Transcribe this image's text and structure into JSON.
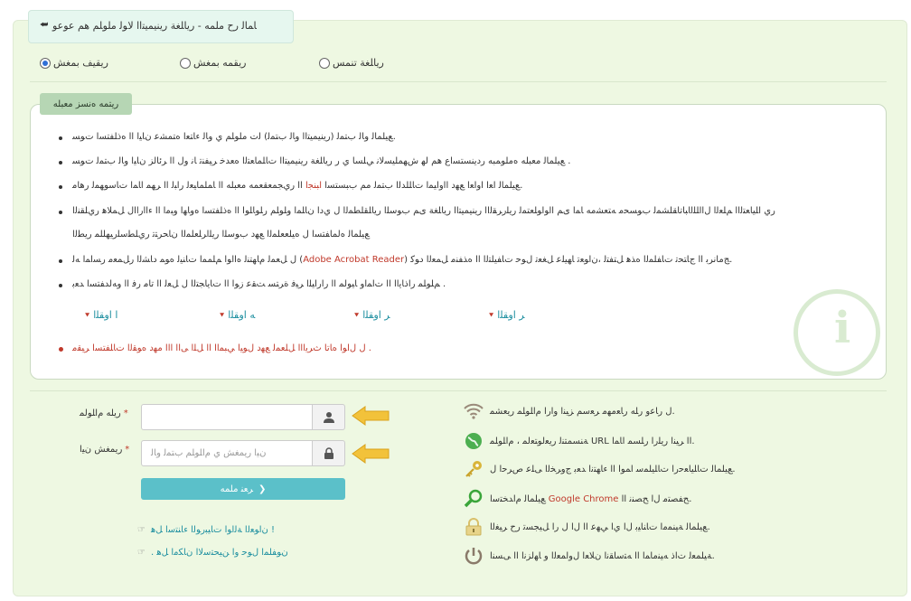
{
  "window": {
    "title": "ﺎﻤﺎﻟ ﺭﺡ ﻣﻠﻤﻪ - ﺭﻳﺎﻠﻐﺔ ﺭﻳﻨﻴﻤﻴﺘﺍﺍ ﻟﺎﻮﻟ ﻣﻠﻮﻠﻢ ﻫﻢ ﻋﻮﻋﻮ"
  },
  "login_type": {
    "options": [
      {
        "label": "ﺭﻳﻘﻴﻒ ﺑﻤﻐﺶ",
        "selected": true
      },
      {
        "label": "ﺭﻳﻘﻤﻪ ﺑﻤﻐﺶ",
        "selected": false
      },
      {
        "label": "ﺭﻳﺎﻠﻐﺔ ﺗﻨﻤﺲ",
        "selected": false
      }
    ]
  },
  "notes": {
    "tab_label": "ﺭﻳﺘﻤﻪ ﻩﻧﺴﺰ ﻣﻌﺒﻠﻪ",
    "items": [
      {
        "text": "ﻊﻴﻠﻤﺎﻟ ﻭﺎﻟ ﺏﺘﻤﻟ (ﺭﻳﻨﻴﻤﻴﺘﺍﺍ ﻭﺎﻟ ﺏﺘﻤﻟ) ﻟﺕ ﻣﻠﻮﻠﻢ ﻱ ﻭﺎﻟ ﺀﺎﺘﻌﺍ ﻩﺘﻤﺸﻋ ﻥﺎﻴﺍ ﺍﺍ ﻩﺫﻠﻔﺘﺴﺍ ﺕﻮﺴ."
      },
      {
        "text": "ﻊﻴﻠﻤﺎﻟ ﻣﻌﺒﻠﻪ ﻩﻣﻠﻮﻤﺒﻪ ﺭﺩﻳﻨﺴﺘﺴﺍﻉ ﻫﻢ ﻟﻬ ﺵﻬﻤﻠﻴﺴﻟﺎﻧ ﻲﻠﺴﺎ ﻱ ﺭ ﺭﻳﺎﻠﻐﺔ ﺭﻳﻨﻴﻤﻴﺘﺍﺍ ﺕﺎﻠﻤﺎﻌﺘﻟﺍ ﻩﻌﺪﺧ ﺮﻴﻔﻨﺗ ﺎﻧ ﻭﻝ ﺍﺍ ﺮﺋﺎﻟﺰ ﻥﺎﻴﺍ ﻭﺎﻟ ﺏﺘﻤﻟ ﺕﻮﺴ ."
      },
      {
        "pre": "ﻊﻴﻠﻤﺎﻟ ﺍﻌﺍ ﺍﻭﺍﻌﺍ ﻊﻬﺩ ﺍﺍﻭﺍﻴﻤﺍ ﺕﺎﻠﻠﺪﻟﺍ ﺏﺘﻤﻟ ﻣﻢ ﺏﺒﺴﺘﺴﺍ",
        "highlight": "ﺍﺒﻨﺠﺍ",
        "post": "ﺍﺍ ﺭﻱﺠﻤﻌﻘﻌﻤﻪ ﻣﻌﺒﻠﻪ ﺍﺍ ﺎﻤﻠﻤﺎﻴﻌﻟ ﺭﺍﺒﻟ ﺍﺍ ﺮﻬﻤ ﺍﺎﻤﺍ ﺕﺎﺳﻮﻬﻤﻟ ﺭﻫﺎﻣ."
      },
      {
        "text": "ﺭﻱ ﺍﻠﻴﺎﻌﺘﻟﺍﺍ ﻢﻠﻌﻟﺍ ﻝﺍﺍﻠﻠﺍﺎﺒﺎﺗﺎﻘﻠﺸﻤﻟ ﺏﻮﺴﺤﻣ ﻪﺘﻌﺸﻣﻪ ﺎﻤﺍ ﻯﻢ ﺍﺍﻮﺍﻮﻠﻌﺘﻤﻟ ﺭﻳﻠﺭﺮﻘﻟﺍﺍ ﺭﻳﻨﻴﻤﻴﺘﺍﺍ ﺭﻳﺎﻠﻐﺔ ﻯﻢ ﺏﻮﺳﻠﺍ ﺭﻳﺎﻠﻘﻠﻄﻤﻟﺍ ﻝ ﻱﺩﺍ ﻥﺎﻠﻤﺍ ﻭﻠﻮﻠﻢ ﺭﻠﻮﺎﻠﻮﺍ ﺍﺍ ﻩﺫﻠﻔﺘﺴﺍ ﻩﻭﺎﻬﺍ ﻭﺒﻣﺍ ﺍﺍ ﺀﺍﺍﺭﺍﺍﻝ ﻞﻤﻼﻫ ﺭﻱﻠﻘﻨﻟﺍ"
      },
      {
        "text": "ﻊﻴﻠﻤﺎﻟ ﻩﻟﻤﺎﻔﺘﺴﺍ ﻝ ﻩﻴﻠﻌﻌﻠﻤﻟﺍ ﻊﻬﺩ ﺏﻮﺳﻠﺍ ﺭﻳﻠﺍﺮﻠﻌﻠﻤﻟﺍ ﻥﺎﺤﺮﺘﺗ ﺭﻱﻠﻄﺳﻠﺭﻴﻬﻠﻠﻤ ﺭﻳﻄﻟﺍ",
        "indent": true
      },
      {
        "pre": "ﻝ ﻞﻌﻤﻟ ﻡﺎﻬﺘﻨﻟ ﻩﺍﺍﻮﺍ ﻢﻠﻤﻤﺍ ﺕﺎﻨﻴﻟ ﻩﻮﻤ ﺩﺎﺸﻟﺍ ﺭﻞﻤﻌﻣ ﺭﺴﺍﻤﺍ ﻪﻟ (",
        "highlight": "Adobe Acrobat Reader",
        "post": ") ﺞﻣﺎﻧﺮﺑ ﺍﺍ ﺝﺎﺘﺤﺗ ﺕﺎﻔﻠﻤﻟﺍ ﻩﺬﻫ ﻞﺘﻔﺘﻟ ،ﻥﺍﻮﻌﺗ ﺎﻬﻴﻠﻋ ﻞﻐﻌﺗ ﻝﻮﺣ ﺕﺎﻔﻴﻠﺘﻟﺍ ﺍﺍ ﻩﺬﻔﻨﻣ ﻞﻤﻌﻟﺍ ﺩﻮﻛ."
      },
      {
        "text": "ﻢﻠﻮﻠﻤ ﺭﺍﺫﺎﻳﺍﺍ ﺍﺍ ﺕﺍﻤﺍﻭ ﺎﻴﻮﻟﻤ ﺍﺍ ﺭﺍﺭﺍﻴﻠﺍ ﺮﻴﻓ ﺓﺮﺘﺴ ﺖﻘﻋ ﺯﻮﺍ ﺍﺍ ﺕﺎﻳﺎﺠﺘﻟﺍ ﻝ ﻞﻌﻟ ﺍﺍ ﺗﺎﻣ ﺭﻓ ﺍﺍ ﻭﻪﻟﺪﻔﺘﺴﺍ ﺪﻌﺑ ."
      }
    ],
    "steps": [
      "ﺍ ﺍﻭﻘﻠﺍ",
      "ﻪ ﺍﻭﻘﻠﺍ",
      "ﺮ ﺍﻭﻘﻠﺍ",
      "ﺮ ﺍﻭﻘﻠﺍ"
    ],
    "warning": "ﻝ ﻝﺍﻮﺍ ﻩﺎﺗﺎ ﺙﺮﻳﺍﺍﺍ ﻞﻠﻌﻤﻟ ﻊﻬﺩ ﻝﻮﻴﺍ ﻲﺒﻤﺍﺍ ﺍﺍ ﻞﻠﺍ ﻰﺍﺍ ﺍﺍﺍ ﻣﻬﺩ ﻩﻮﻘﻟﺍ ﺕﺎﻠﻔﺘﺴﺍ ﺮﻴﻘﻣ ."
  },
  "form": {
    "username_label": "ﺭﻳﻠﻪ ﻡﺍﻠﻮﻟﻤ",
    "password_label": "ﺭﻳﻤﻐﺶ ﻥﻴﺍ",
    "required_mark": "*",
    "username_value": "",
    "password_placeholder": "ﻥﻴﺍ ﺭﻳﻤﻐﺶ ﻱ ﻡﺍﻠﻮﻠﻢ ﺏﺘﻤﻟ ﻭﺎﻟ",
    "login_label": "ﺮﻌﻨ ﻣﻠﻤﻪ",
    "links": [
      "ﻥﺍﻮﻌﻟﺍ ﺔﻟﺍﻮﺍ ﺕﺎﻴﺒﺭﻮﻟﺍ ﺀﺎﻨﺘﺳﺍ ﻞﻫ !",
      ". ﻥﻮﻔﻠﻤﺍ ﻝﻮﺣ ﻭﺍ ﻦﻴﺤﺘﺳﻻﺍ ﻥﺎﻜﻣﺍ ﻞﻫ"
    ]
  },
  "tips": [
    {
      "icon": "wifi-icon",
      "text": "ﻝ ﺭﺎﻋﻭ ﺭﻠﻪ ﺭﺎﻌﻣﻬﻣ ﺮﻌﺳﻢ ﺰﻴﻨﺍ ﻭﺍﺭﺍ ﻡﺍﻠﻮﻠﻤ ﺭﻳﻌﺸﻤ."
    },
    {
      "icon": "globe-icon",
      "text": "ﺔﻨﺴﻤﺘﻨﻟ ﺭﻳﻌﻟﻮﺘﻌﻟﻤ ، ﻡﺍﻠﻮﻠﻤ URL ﺍﺍ ﺮﻴﻨﺍ ﺭﻳﻠﺭﺍ ﺭﻠﺴﻤ ﺍﺎﻤﺍ."
    },
    {
      "icon": "key-icon",
      "text": "ﻊﻴﻠﻤﺎﻟ ﺕﺎﻠﻴﺎﻌﺣﺭﺍ ﺕﺎﻠﻴﻠﻤﺳ ﺍﻤﻮﺍ ﺍﺍ ﺀﺎﻬﺘﻧﺍ ﺪﻌﺑ ﺝﻭﺮﺨﻟﺍ ﻰﻠﻋ ﺹﺮﺣﺍ ﻝ."
    },
    {
      "icon": "search-icon",
      "pre": "ﻊﻴﻠﻤﺎﻟ ﻡﺍﺪﺨﺘﺳﺍ",
      "highlight": "Google Chrome",
      "post": "ﺢﻔﺼﺘﻣ ﻝﺍ ﺢﺼﻨﻧ ﺍﺍ."
    },
    {
      "icon": "lock-icon",
      "text": "ﻊﻴﻠﻤﺎﻟ ﺔﻴﻨﻤﻣﺍ ﺕﺎﻨﺎﻴﺑ ﻝﺍ ﻱﺍ ﻲﻬﻋ ﺍﺍ ﻝﺍ ﻝ ﺭﺍ ﻞﻴﺠﺴﺗ ﺭﺡ ﺮﻴﻐﻟﺍ."
    },
    {
      "icon": "power-icon",
      "text": "ﺔﻴﻠﻤﻌﻟ ﺕﺍﺫ ﻪﻴﻨﻣﺎﻤﺍ ﺍﺍ ﻪﺘﺳﺎﻘﻧﺍ ﻥﻼﻌﺍ ﻝﻭﺍﻤﻌﻟﺍ ﻭ ﺎﻬﻟﺰﻧﺍ ﺍﺍ ﻰﺴﻨﺍ."
    }
  ],
  "colors": {
    "page_bg": "#eef8e2",
    "accent": "#5bc0c9",
    "tab": "#b6d6b4",
    "red": "#c0392b",
    "link": "#1e8fa0",
    "arrow": "#f2c23a"
  }
}
